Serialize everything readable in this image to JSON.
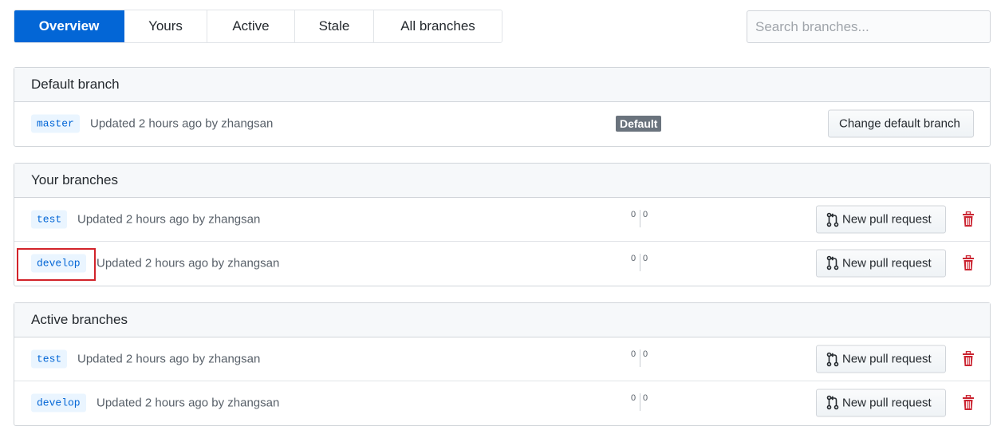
{
  "tabs": [
    "Overview",
    "Yours",
    "Active",
    "Stale",
    "All branches"
  ],
  "search": {
    "placeholder": "Search branches..."
  },
  "default_section": {
    "title": "Default branch",
    "branch": "master",
    "meta": "Updated 2 hours ago by zhangsan",
    "badge": "Default",
    "button": "Change default branch"
  },
  "your_section": {
    "title": "Your branches",
    "rows": [
      {
        "branch": "test",
        "meta": "Updated 2 hours ago by zhangsan",
        "ahead": "0",
        "behind": "0",
        "button": "New pull request"
      },
      {
        "branch": "develop",
        "meta": "Updated 2 hours ago by zhangsan",
        "ahead": "0",
        "behind": "0",
        "button": "New pull request"
      }
    ]
  },
  "active_section": {
    "title": "Active branches",
    "rows": [
      {
        "branch": "test",
        "meta": "Updated 2 hours ago by zhangsan",
        "ahead": "0",
        "behind": "0",
        "button": "New pull request"
      },
      {
        "branch": "develop",
        "meta": "Updated 2 hours ago by zhangsan",
        "ahead": "0",
        "behind": "0",
        "button": "New pull request"
      }
    ]
  },
  "colors": {
    "accent": "#0366d6",
    "danger": "#cb2431",
    "highlight": "#d2232a",
    "badge": "#6a737d"
  },
  "icons": {
    "pull_request": "git-pull-request-icon",
    "delete": "trash-icon"
  }
}
